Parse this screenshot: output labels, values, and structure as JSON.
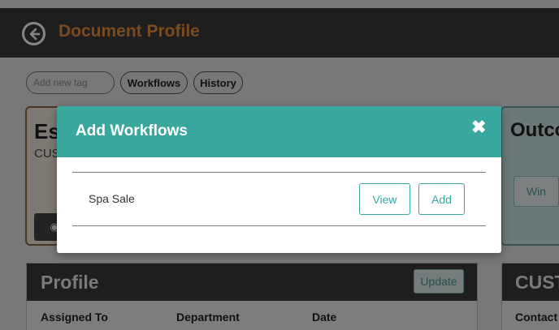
{
  "header": {
    "title": "Document Profile",
    "back_icon": "arrow-left-circle-icon"
  },
  "tagbar": {
    "tag_placeholder": "Add new tag",
    "workflows_label": "Workflows",
    "history_label": "History"
  },
  "left_card": {
    "title_partial": "Es",
    "subtitle_partial": "CUS",
    "eye_icon": "eye-icon",
    "eye_label": "◉"
  },
  "right_card": {
    "title_partial": "Outco",
    "win_label": "Win"
  },
  "profile": {
    "title": "Profile",
    "update_label": "Update",
    "columns": [
      "Assigned To",
      "Department",
      "Date"
    ]
  },
  "customer_card": {
    "title_partial": "CUST",
    "column": "Contact"
  },
  "modal": {
    "title": "Add Workflows",
    "close_label": "✖",
    "workflows": [
      {
        "name": "Spa Sale",
        "view_label": "View",
        "add_label": "Add"
      }
    ]
  },
  "colors": {
    "header_bg": "#3a3a3a",
    "header_title": "#e8913a",
    "modal_accent": "#3aa79e",
    "overlay": "rgba(0,0,0,0.48)"
  }
}
